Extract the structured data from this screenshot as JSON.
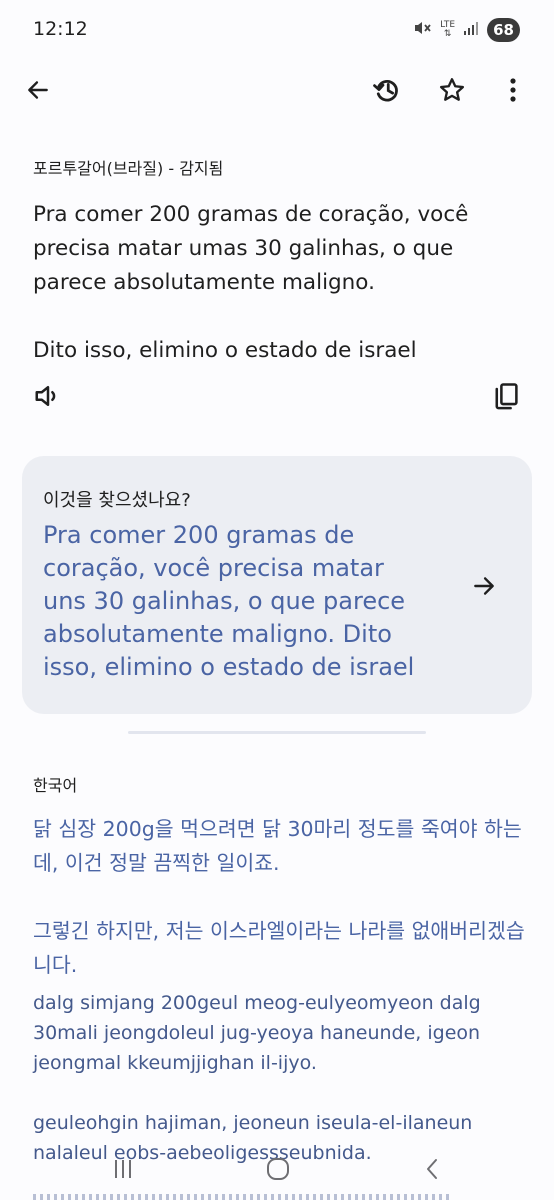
{
  "status": {
    "time": "12:12",
    "network": "LTE",
    "battery": "68",
    "icons": [
      "mute-icon",
      "lte-icon",
      "signal-icon",
      "battery-icon"
    ]
  },
  "app_bar": {
    "icons": [
      "back-arrow-icon",
      "history-icon",
      "star-icon",
      "more-vert-icon"
    ]
  },
  "source": {
    "language_label": "포르투갈어(브라질) - 감지됨",
    "text": "Pra comer 200 gramas de coração, você precisa matar umas 30 galinhas, o que parece absolutamente maligno.\n\nDito isso, elimino o estado de israel"
  },
  "suggestion": {
    "label": "이것을 찾으셨나요?",
    "text": "Pra comer 200 gramas de coração, você precisa matar uns 30 galinhas, o que parece absolutamente maligno. Dito isso, elimino o estado de israel"
  },
  "target": {
    "language_label": "한국어",
    "text": "닭 심장 200g을 먹으려면 닭 30마리 정도를 죽여야 하는데, 이건 정말 끔찍한 일이죠.\n\n그렇긴 하지만, 저는 이스라엘이라는 나라를 없애버리겠습니다.",
    "romanization": "dalg simjang 200geul meog-eulyeomyeon dalg 30mali jeongdoleul jug-yeoya haneunde, igeon jeongmal kkeumjjighan il-ijyo.\n\ngeuleohgin hajiman, jeoneun iseula-el-ilaneun nalaleul eobs-aebeoligessseubnida."
  },
  "colors": {
    "accent_text": "#4a64a4",
    "card_bg": "#eceef3",
    "background": "#fcfcfe"
  }
}
